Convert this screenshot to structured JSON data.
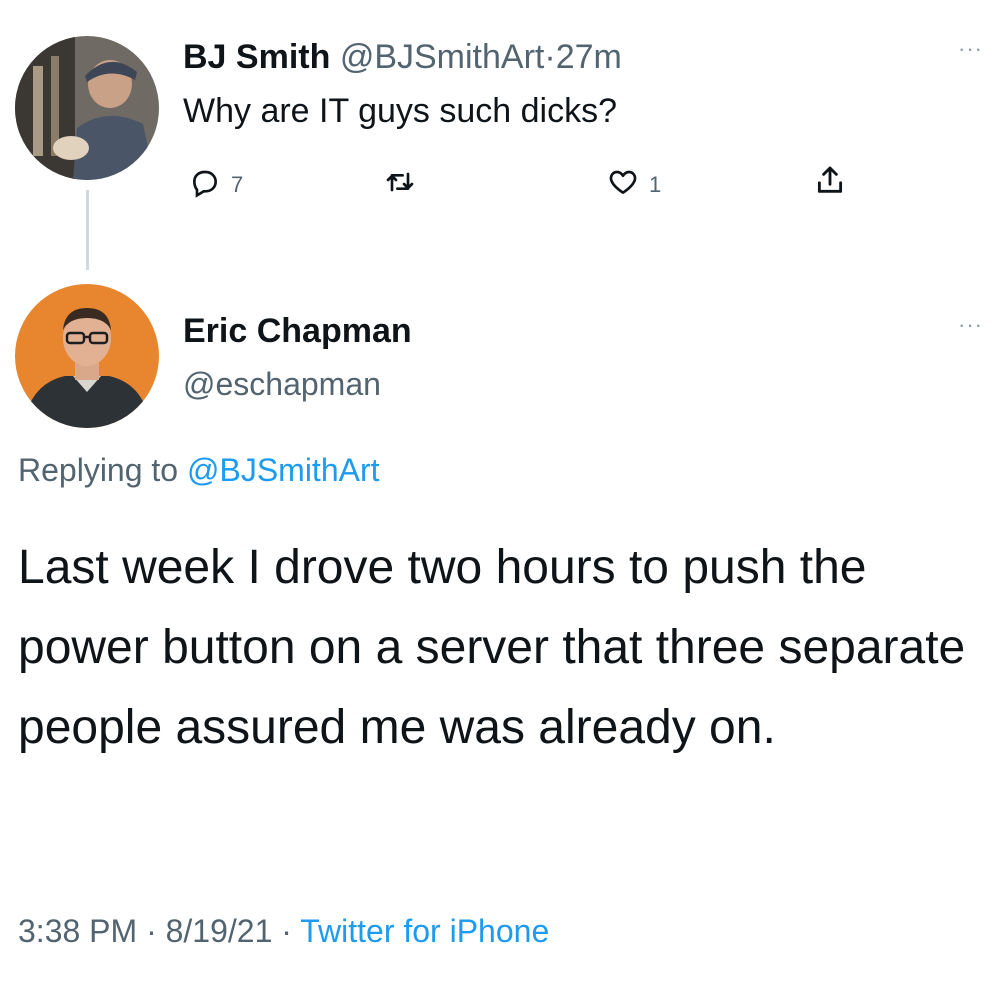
{
  "tweet": {
    "author_name": "BJ Smith",
    "author_handle": "@BJSmithArt",
    "separator": "·",
    "time": "27m",
    "text": "Why are IT guys such dicks?",
    "reply_count": "7",
    "like_count": "1",
    "more_label": "···"
  },
  "reply": {
    "author_name": "Eric Chapman",
    "author_handle": "@eschapman",
    "replying_prefix": "Replying to",
    "replying_to": "@BJSmithArt",
    "text": "Last week I drove two hours to push the power button on a server that three separate people assured me was already on.",
    "timestamp_time": "3:38 PM",
    "separator": "·",
    "timestamp_date": "8/19/21",
    "source": "Twitter for iPhone",
    "more_label": "···"
  },
  "colors": {
    "text": "#0f1419",
    "muted": "#536471",
    "link": "#1d9bf0",
    "thread_line": "#cfd9de",
    "eric_avatar_bg": "#e8862f"
  },
  "icons": [
    "reply-icon",
    "retweet-icon",
    "like-icon",
    "share-icon",
    "more-icon"
  ]
}
